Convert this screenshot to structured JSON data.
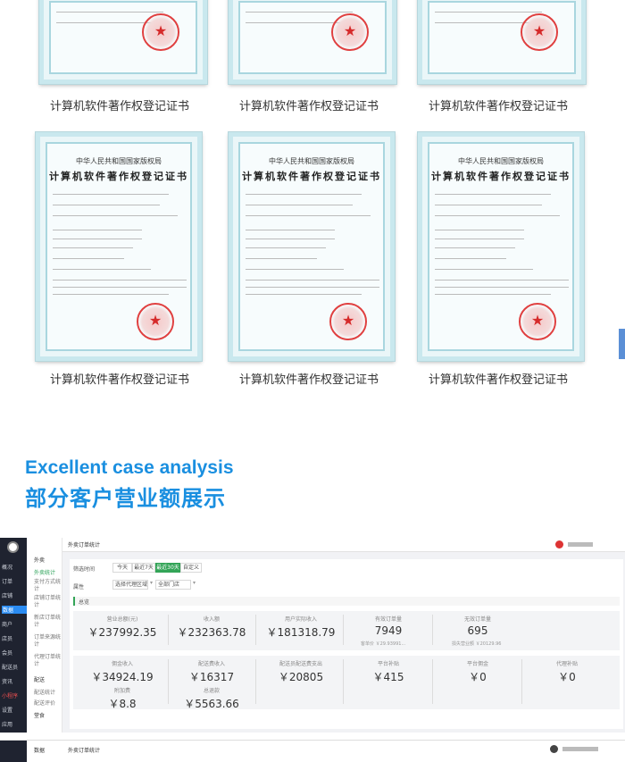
{
  "certificates": {
    "caption": "计算机软件著作权登记证书",
    "header_line1": "中华人民共和国国家版权局",
    "header_line2": "计算机软件著作权登记证书"
  },
  "section": {
    "english_title": "Excellent case analysis",
    "chinese_title": "部分客户营业额展示"
  },
  "admin": {
    "top_label": "数据",
    "breadcrumb": "外卖订单统计",
    "sidebar_items": [
      "概况",
      "订单",
      "店铺",
      "数据",
      "商户",
      "店员",
      "会员",
      "配送员",
      "资讯",
      "小程序",
      "设置",
      "应用"
    ],
    "side2_items": [
      "外卖",
      "外卖统计",
      "支付方式统计",
      "店铺订单统计",
      "新店订单统计",
      "订单来源统计",
      "代理订单统计",
      "配送",
      "配送统计",
      "配送评价",
      "堂食"
    ],
    "filter": {
      "label": "筛选时间",
      "buttons": [
        "今天",
        "最近7天",
        "最近30天",
        "自定义"
      ],
      "active": "最近30天",
      "attr_label": "属性",
      "select1": "选择代理区域",
      "select2": "全部门店"
    },
    "overview_label": "总览",
    "row1": [
      {
        "label": "营业总额(元)",
        "value": "￥237992.35"
      },
      {
        "label": "收入额",
        "value": "￥232363.78"
      },
      {
        "label": "用户实际收入",
        "value": "￥181318.79"
      },
      {
        "label": "有效订单量",
        "value": "7949",
        "sub": "客单价 ￥29.93991..."
      },
      {
        "label": "无效订单量",
        "value": "695",
        "sub": "损失营业额 ￥20129.96"
      }
    ],
    "row2": [
      {
        "label": "佣金收入",
        "value": "￥34924.19",
        "label2": "附加费",
        "value2": "￥8.8"
      },
      {
        "label": "配送费收入",
        "value": "￥16317",
        "label2": "总退款",
        "value2": "￥5563.66"
      },
      {
        "label": "配送员配送费支出",
        "value": "￥20805"
      },
      {
        "label": "平台补贴",
        "value": "￥415"
      },
      {
        "label": "平台佣金",
        "value": "￥0"
      },
      {
        "label": "代理补贴",
        "value": "￥0"
      }
    ],
    "bottom_top_label": "数据",
    "bottom_breadcrumb": "外卖订单统计"
  }
}
